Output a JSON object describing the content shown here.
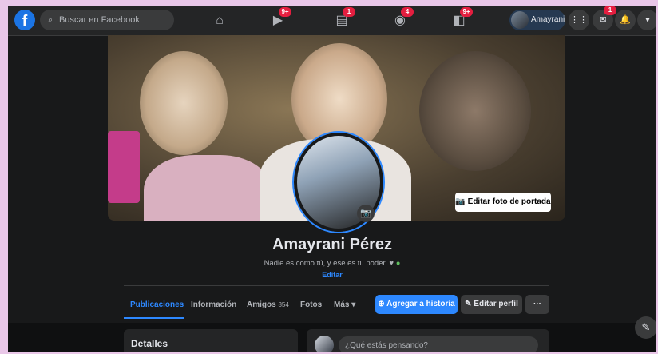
{
  "search": {
    "placeholder": "Buscar en Facebook"
  },
  "nav": {
    "home_icon": "home-icon",
    "items": [
      {
        "icon": "watch-icon",
        "badge": "9+"
      },
      {
        "icon": "marketplace-icon",
        "badge": "1"
      },
      {
        "icon": "groups-icon",
        "badge": "4"
      },
      {
        "icon": "gaming-icon",
        "badge": "9+"
      }
    ]
  },
  "user": {
    "name": "Amayrani"
  },
  "right_controls": {
    "messenger_badge": "1"
  },
  "cover": {
    "edit_label": "Editar foto de portada"
  },
  "profile": {
    "name": "Amayrani Pérez",
    "bio": "Nadie es como tú, y ese es tu poder..♥",
    "edit_label": "Editar"
  },
  "tabs": [
    {
      "label": "Publicaciones"
    },
    {
      "label": "Información"
    },
    {
      "label": "Amigos",
      "count": "854"
    },
    {
      "label": "Fotos"
    },
    {
      "label": "Más ▾"
    }
  ],
  "actions": {
    "add_story": "Agregar a historia",
    "edit_profile": "Editar perfil",
    "more": "···"
  },
  "details": {
    "title": "Detalles"
  },
  "composer": {
    "placeholder": "¿Qué estás pensando?"
  },
  "colors": {
    "accent": "#2d88ff",
    "badge": "#e41e3f",
    "bg": "#18191a",
    "surface": "#242526"
  }
}
